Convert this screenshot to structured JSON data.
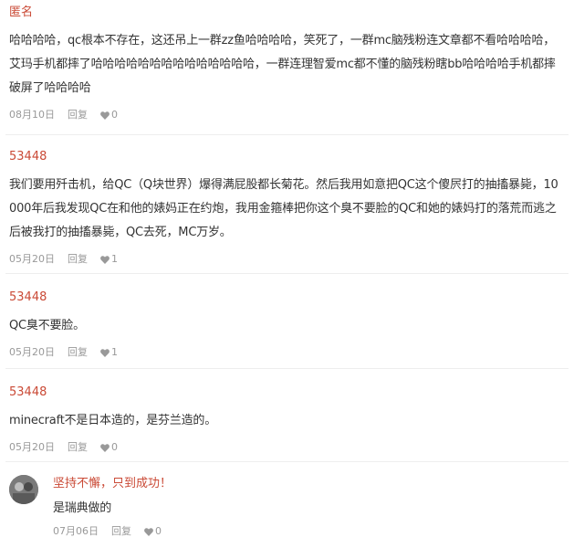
{
  "comments": [
    {
      "username": "匿名",
      "content": "哈哈哈哈，qc根本不存在，这还吊上一群zz鱼哈哈哈哈，笑死了，一群mc脑残粉连文章都不看哈哈哈哈，艾玛手机都摔了哈哈哈哈哈哈哈哈哈哈哈哈哈哈，一群连理智爱mc都不懂的脑残粉瞎bb哈哈哈哈手机都摔破屏了哈哈哈哈",
      "date": "08月10日",
      "reply_label": "回复",
      "likes": "0"
    },
    {
      "username": "53448",
      "content": "我们要用歼击机，给QC（Q块世界）爆得满屁股都长菊花。然后我用如意把QC这个傻屄打的抽搐暴毙，10000年后我发现QC在和他的婊妈正在约炮，我用金箍棒把你这个臭不要脸的QC和她的婊妈打的落荒而逃之后被我打的抽搐暴毙，QC去死，MC万岁。",
      "date": "05月20日",
      "reply_label": "回复",
      "likes": "1"
    },
    {
      "username": "53448",
      "content": "QC臭不要脸。",
      "date": "05月20日",
      "reply_label": "回复",
      "likes": "1"
    },
    {
      "username": "53448",
      "content": "minecraft不是日本造的，是芬兰造的。",
      "date": "05月20日",
      "reply_label": "回复",
      "likes": "0"
    },
    {
      "username": "坚持不懈，只到成功！",
      "content": "是瑞典做的",
      "date": "07月06日",
      "reply_label": "回复",
      "likes": "0"
    }
  ],
  "colors": {
    "username": "#ca4a36",
    "text": "#333333",
    "meta": "#999999",
    "divider": "#eeeeee"
  },
  "icons": {
    "like": "heart-icon",
    "avatar": "user-avatar"
  }
}
